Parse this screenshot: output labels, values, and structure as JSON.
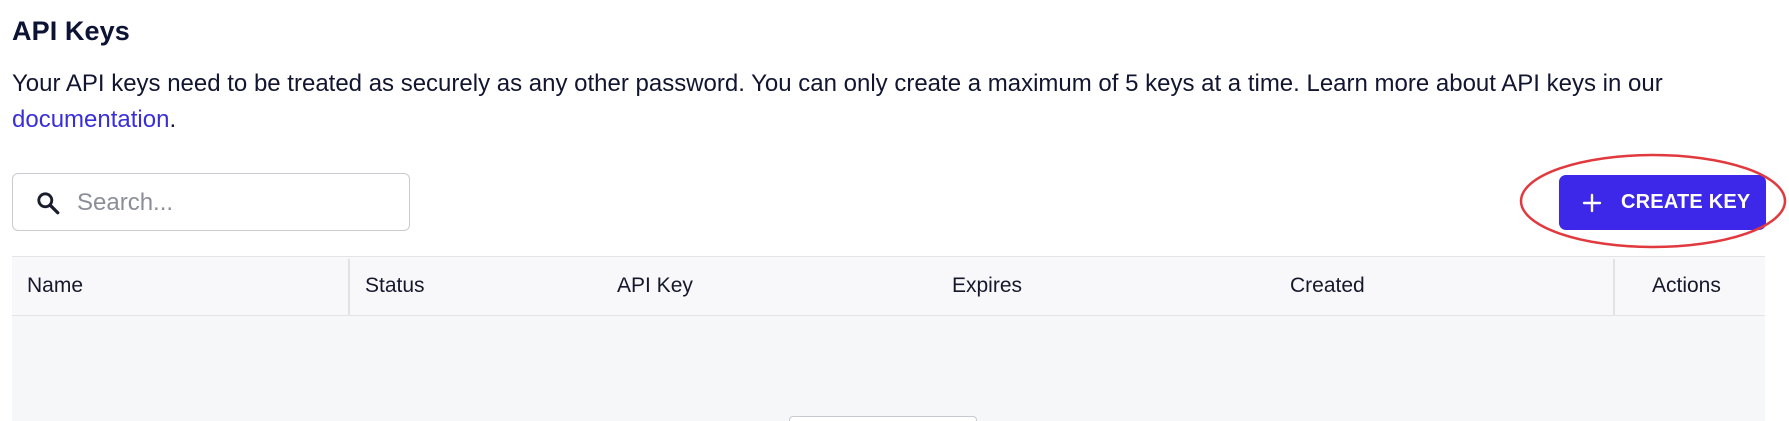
{
  "header": {
    "title": "API Keys"
  },
  "description": {
    "text": "Your API keys need to be treated as securely as any other password. You can only create a maximum of 5 keys at a time. Learn more about API keys in our ",
    "link_text": "documentation",
    "suffix": "."
  },
  "search": {
    "icon": "search-icon",
    "placeholder": "Search...",
    "value": ""
  },
  "toolbar": {
    "create_label": "CREATE KEY",
    "create_icon": "plus-icon",
    "accent_color": "#3d27e8",
    "highlight_color": "#e0393e"
  },
  "table": {
    "columns": [
      "Name",
      "Status",
      "API Key",
      "Expires",
      "Created",
      "Actions"
    ],
    "rows": []
  }
}
